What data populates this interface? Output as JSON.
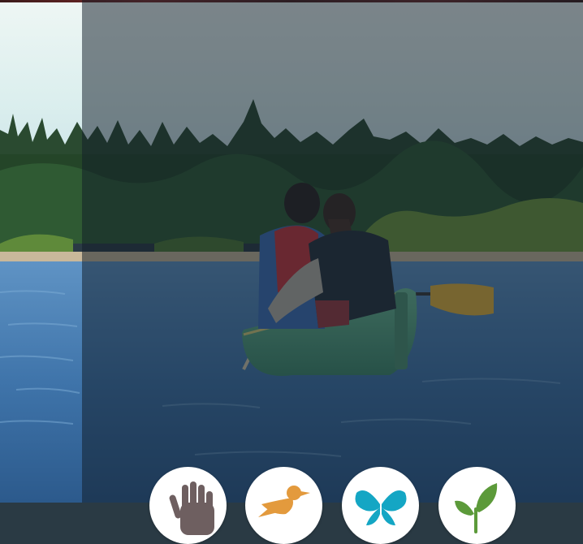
{
  "hero": {
    "image": "canoe-on-lake-photo",
    "overlay_color": "#121c28"
  },
  "activity_icons": [
    {
      "icon": "hand-icon",
      "color": "#6e5f60"
    },
    {
      "icon": "bird-icon",
      "color": "#e39a3d"
    },
    {
      "icon": "butterfly-icon",
      "color": "#14a6c4"
    },
    {
      "icon": "leaf-icon",
      "color": "#5c9a3a"
    }
  ]
}
